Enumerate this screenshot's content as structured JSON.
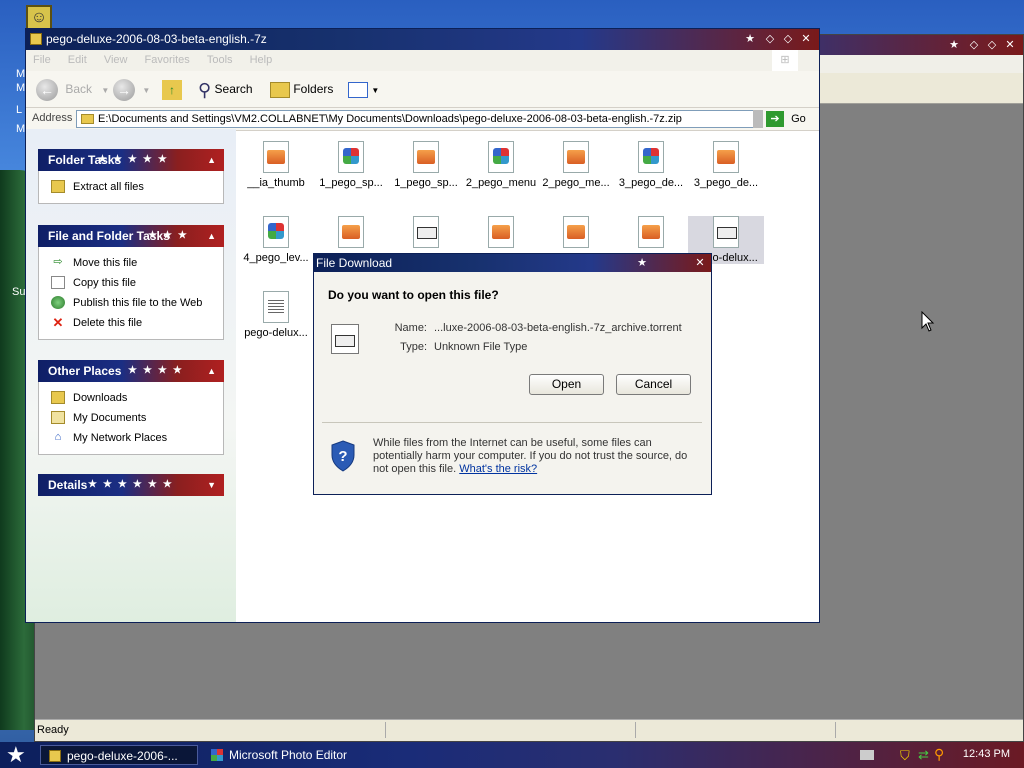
{
  "desktop": {
    "icon_letters": [
      "M",
      "M",
      "L",
      "M",
      "Su"
    ]
  },
  "back_window": {
    "status_text": "Ready"
  },
  "explorer": {
    "title": "pego-deluxe-2006-08-03-beta-english.-7z",
    "menu": [
      "File",
      "Edit",
      "View",
      "Favorites",
      "Tools",
      "Help"
    ],
    "toolbar": {
      "back": "Back",
      "search": "Search",
      "folders": "Folders"
    },
    "address": {
      "label": "Address",
      "value": "E:\\Documents and Settings\\VM2.COLLABNET\\My Documents\\Downloads\\pego-deluxe-2006-08-03-beta-english.-7z.zip",
      "go": "Go"
    },
    "panels": {
      "folder_tasks": {
        "title": "Folder Tasks",
        "items": [
          "Extract all files"
        ]
      },
      "file_folder_tasks": {
        "title": "File and Folder Tasks",
        "items": [
          "Move this file",
          "Copy this file",
          "Publish this file to the Web",
          "Delete this file"
        ]
      },
      "other_places": {
        "title": "Other Places",
        "items": [
          "Downloads",
          "My Documents",
          "My Network Places"
        ]
      },
      "details": {
        "title": "Details"
      }
    },
    "files": [
      {
        "name": "__ia_thumb",
        "type": "img"
      },
      {
        "name": "1_pego_sp...",
        "type": "pe"
      },
      {
        "name": "1_pego_sp...",
        "type": "img"
      },
      {
        "name": "2_pego_menu",
        "type": "pe"
      },
      {
        "name": "2_pego_me...",
        "type": "img"
      },
      {
        "name": "3_pego_de...",
        "type": "pe"
      },
      {
        "name": "3_pego_de...",
        "type": "img"
      },
      {
        "name": "4_pego_lev...",
        "type": "pe"
      },
      {
        "name": "",
        "type": "img"
      },
      {
        "name": "",
        "type": "doc"
      },
      {
        "name": "",
        "type": "img"
      },
      {
        "name": "",
        "type": "img"
      },
      {
        "name": "",
        "type": "img"
      },
      {
        "name": "pego-delux...",
        "type": "doc"
      },
      {
        "name": "pego-delux...",
        "type": "txt"
      }
    ]
  },
  "dialog": {
    "title": "File Download",
    "question": "Do you want to open this file?",
    "name_label": "Name:",
    "name_value": "...luxe-2006-08-03-beta-english.-7z_archive.torrent",
    "type_label": "Type:",
    "type_value": "Unknown File Type",
    "open_button": "Open",
    "cancel_button": "Cancel",
    "warning": "While files from the Internet can be useful, some files can potentially harm your computer. If you do not trust the source, do not open this file.",
    "risk_link": "What's the risk?"
  },
  "taskbar": {
    "tasks": [
      "pego-deluxe-2006-...",
      "Microsoft Photo Editor"
    ],
    "clock": "12:43 PM"
  }
}
